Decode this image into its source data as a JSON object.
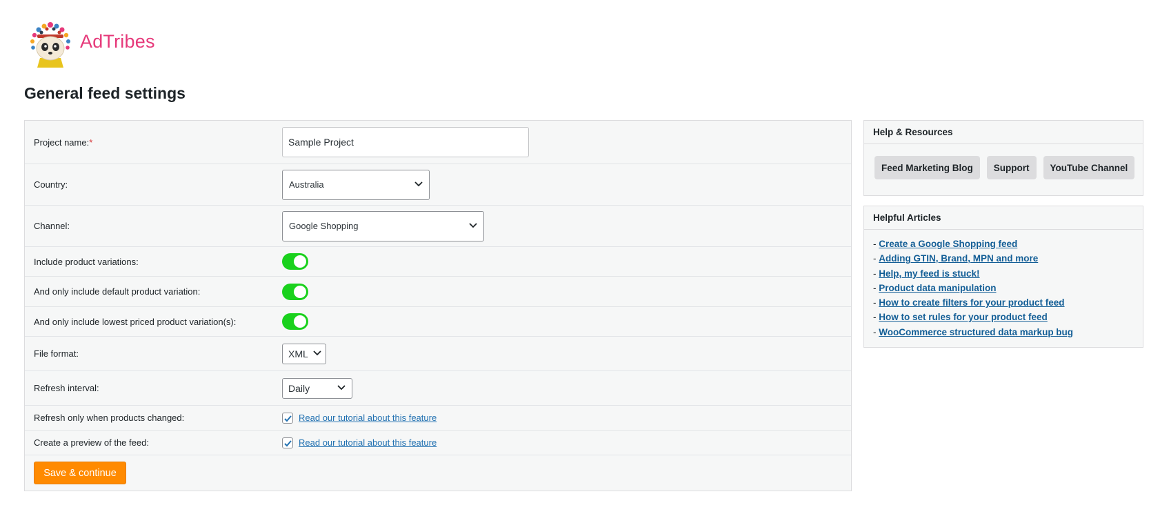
{
  "brand": {
    "name": "AdTribes",
    "logo_icon": "panda-headdress-logo"
  },
  "page": {
    "title": "General feed settings"
  },
  "form": {
    "project_name": {
      "label": "Project name:",
      "required_mark": "*",
      "value": "Sample Project"
    },
    "country": {
      "label": "Country:",
      "value": "Australia"
    },
    "channel": {
      "label": "Channel:",
      "value": "Google Shopping"
    },
    "include_variations": {
      "label": "Include product variations:",
      "on": true
    },
    "default_variation": {
      "label": "And only include default product variation:",
      "on": true
    },
    "lowest_variation": {
      "label": "And only include lowest priced product variation(s):",
      "on": true
    },
    "file_format": {
      "label": "File format:",
      "value": "XML"
    },
    "refresh_interval": {
      "label": "Refresh interval:",
      "value": "Daily"
    },
    "refresh_changed": {
      "label": "Refresh only when products changed:",
      "checked": true,
      "link": "Read our tutorial about this feature"
    },
    "preview": {
      "label": "Create a preview of the feed:",
      "checked": true,
      "link": "Read our tutorial about this feature"
    },
    "save_label": "Save & continue"
  },
  "help": {
    "title": "Help & Resources",
    "buttons": [
      "Feed Marketing Blog",
      "Support",
      "YouTube Channel"
    ]
  },
  "articles": {
    "title": "Helpful Articles",
    "bullet": "- ",
    "items": [
      "Create a Google Shopping feed",
      "Adding GTIN, Brand, MPN and more",
      "Help, my feed is stuck!",
      "Product data manipulation",
      "How to create filters for your product feed",
      "How to set rules for your product feed",
      "WooCommerce structured data markup bug"
    ]
  },
  "colors": {
    "accent": "#ff8a00",
    "toggle_on": "#1ad11d",
    "brand": "#e6397a",
    "link": "#2271b1"
  }
}
